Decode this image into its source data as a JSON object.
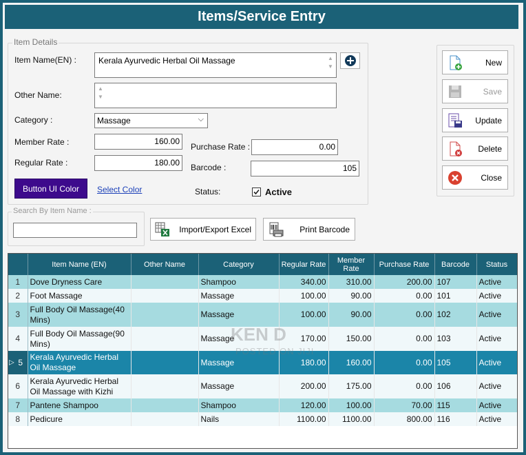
{
  "window": {
    "title": "Items/Service Entry"
  },
  "details": {
    "legend": "Item Details",
    "item_name_label": "Item Name(EN) :",
    "item_name_value": "Kerala Ayurvedic Herbal Oil Massage",
    "other_name_label": "Other Name:",
    "other_name_value": "",
    "category_label": "Category :",
    "category_value": "Massage",
    "member_rate_label": "Member Rate :",
    "member_rate_value": "160.00",
    "regular_rate_label": "Regular Rate :",
    "regular_rate_value": "180.00",
    "purchase_rate_label": "Purchase Rate :",
    "purchase_rate_value": "0.00",
    "barcode_label": "Barcode :",
    "barcode_value": "105",
    "status_label": "Status:",
    "status_value": "Active",
    "button_ui_color": "Button UI Color",
    "select_color": "Select Color"
  },
  "actions": {
    "new": "New",
    "save": "Save",
    "update": "Update",
    "delete": "Delete",
    "close": "Close"
  },
  "search": {
    "legend": "Search By Item Name :",
    "value": ""
  },
  "tools": {
    "import_export": "Import/Export Excel",
    "print_barcode": "Print Barcode"
  },
  "grid": {
    "columns": [
      "Item Name (EN)",
      "Other Name",
      "Category",
      "Regular Rate",
      "Member Rate",
      "Purchase Rate",
      "Barcode",
      "Status"
    ],
    "rows": [
      {
        "no": "1",
        "name": "Dove Dryness Care",
        "other": "",
        "category": "Shampoo",
        "regular": "340.00",
        "member": "310.00",
        "purchase": "200.00",
        "barcode": "107",
        "status": "Active"
      },
      {
        "no": "2",
        "name": "Foot Massage",
        "other": "",
        "category": "Massage",
        "regular": "100.00",
        "member": "90.00",
        "purchase": "0.00",
        "barcode": "101",
        "status": "Active"
      },
      {
        "no": "3",
        "name": "Full Body Oil Massage(40 Mins)",
        "other": "",
        "category": "Massage",
        "regular": "100.00",
        "member": "90.00",
        "purchase": "0.00",
        "barcode": "102",
        "status": "Active"
      },
      {
        "no": "4",
        "name": "Full Body Oil Massage(90 Mins)",
        "other": "",
        "category": "Massage",
        "regular": "170.00",
        "member": "150.00",
        "purchase": "0.00",
        "barcode": "103",
        "status": "Active"
      },
      {
        "no": "5",
        "name": "Kerala Ayurvedic Herbal Oil Massage",
        "other": "",
        "category": "Massage",
        "regular": "180.00",
        "member": "160.00",
        "purchase": "0.00",
        "barcode": "105",
        "status": "Active"
      },
      {
        "no": "6",
        "name": "Kerala Ayurvedic Herbal Oil Massage with Kizhi",
        "other": "",
        "category": "Massage",
        "regular": "200.00",
        "member": "175.00",
        "purchase": "0.00",
        "barcode": "106",
        "status": "Active"
      },
      {
        "no": "7",
        "name": "Pantene Shampoo",
        "other": "",
        "category": "Shampoo",
        "regular": "120.00",
        "member": "100.00",
        "purchase": "70.00",
        "barcode": "115",
        "status": "Active"
      },
      {
        "no": "8",
        "name": "Pedicure",
        "other": "",
        "category": "Nails",
        "regular": "1100.00",
        "member": "1100.00",
        "purchase": "800.00",
        "barcode": "116",
        "status": "Active"
      }
    ]
  },
  "watermark": {
    "line1": "KEN D",
    "line2": "POSTED ON JIJI"
  },
  "colors": {
    "accent": "#1b6177",
    "selected_row": "#1b85a8",
    "alt_row": "#a6dbe0",
    "button_purple": "#3d0a8c"
  }
}
